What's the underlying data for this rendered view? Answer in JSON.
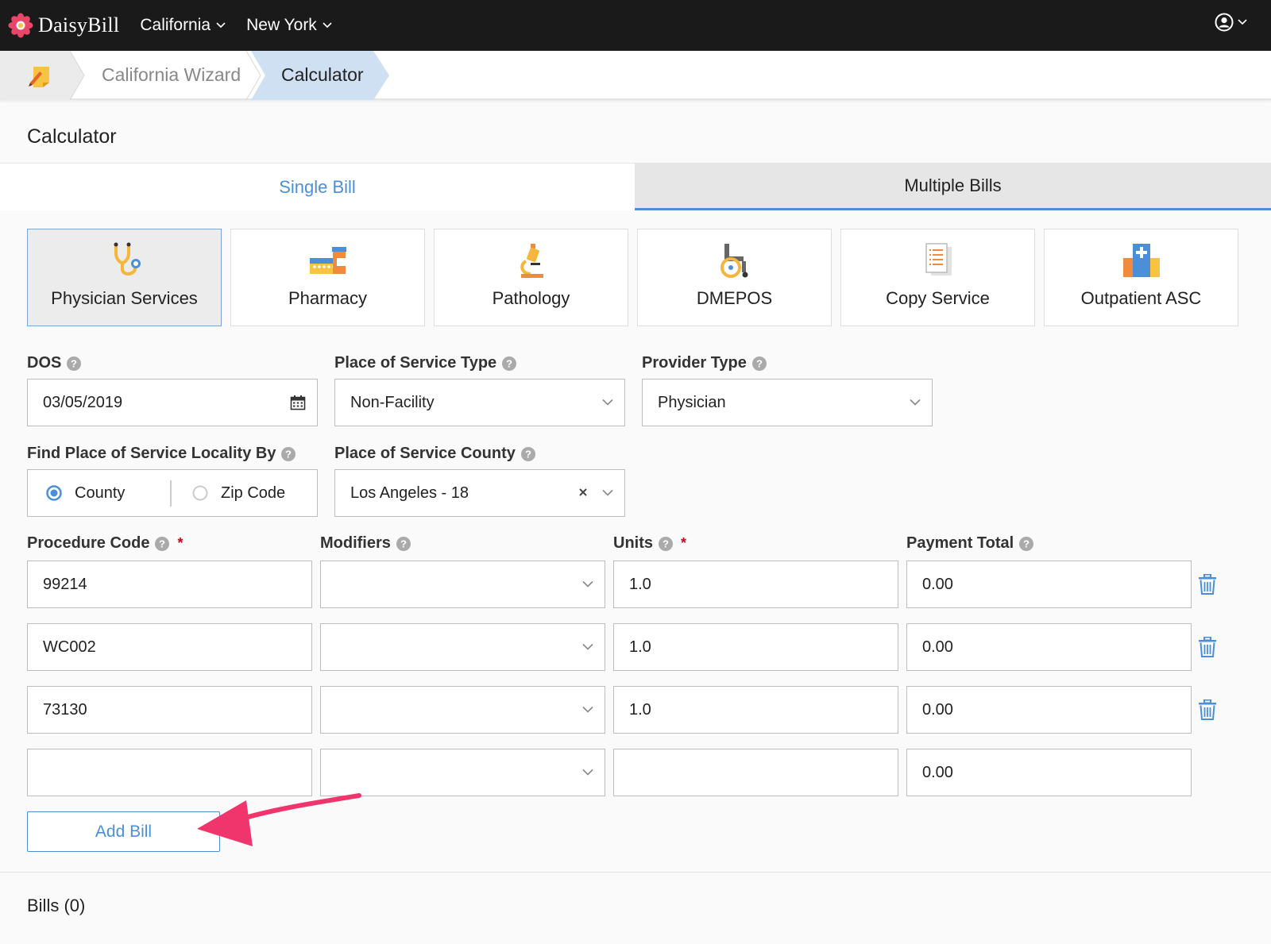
{
  "app": {
    "brand": "DaisyBill"
  },
  "topnav": {
    "menus": [
      {
        "label": "California"
      },
      {
        "label": "New York"
      }
    ]
  },
  "breadcrumb": {
    "items": [
      {
        "label": "California Wizard"
      },
      {
        "label": "Calculator"
      }
    ]
  },
  "page": {
    "title": "Calculator"
  },
  "tabs": [
    {
      "label": "Single Bill",
      "active": true
    },
    {
      "label": "Multiple Bills",
      "active": false
    }
  ],
  "service_types": [
    {
      "label": "Physician Services",
      "icon": "stethoscope-icon",
      "selected": true
    },
    {
      "label": "Pharmacy",
      "icon": "pharmacy-icon",
      "selected": false
    },
    {
      "label": "Pathology",
      "icon": "microscope-icon",
      "selected": false
    },
    {
      "label": "DMEPOS",
      "icon": "wheelchair-icon",
      "selected": false
    },
    {
      "label": "Copy Service",
      "icon": "document-icon",
      "selected": false
    },
    {
      "label": "Outpatient ASC",
      "icon": "hospital-icon",
      "selected": false
    }
  ],
  "form": {
    "dos": {
      "label": "DOS",
      "value": "03/05/2019"
    },
    "place_of_service_type": {
      "label": "Place of Service Type",
      "value": "Non-Facility"
    },
    "provider_type": {
      "label": "Provider Type",
      "value": "Physician"
    },
    "locality_by": {
      "label": "Find Place of Service Locality By",
      "options": [
        "County",
        "Zip Code"
      ],
      "selected": "County"
    },
    "county": {
      "label": "Place of Service County",
      "value": "Los Angeles - 18"
    },
    "columns": {
      "procedure_code": "Procedure Code",
      "modifiers": "Modifiers",
      "units": "Units",
      "payment_total": "Payment Total"
    },
    "required_marker": "*",
    "rows": [
      {
        "procedure_code": "99214",
        "modifiers": "",
        "units": "1.0",
        "payment_total": "0.00"
      },
      {
        "procedure_code": "WC002",
        "modifiers": "",
        "units": "1.0",
        "payment_total": "0.00"
      },
      {
        "procedure_code": "73130",
        "modifiers": "",
        "units": "1.0",
        "payment_total": "0.00"
      },
      {
        "procedure_code": "",
        "modifiers": "",
        "units": "",
        "payment_total": "0.00"
      }
    ]
  },
  "add_bill_label": "Add Bill",
  "bills_count_label": "Bills (0)",
  "colors": {
    "accent": "#4a8fd8",
    "topnav": "#1a1a1a",
    "annotation_arrow": "#f0356d",
    "required": "#d0021b"
  }
}
